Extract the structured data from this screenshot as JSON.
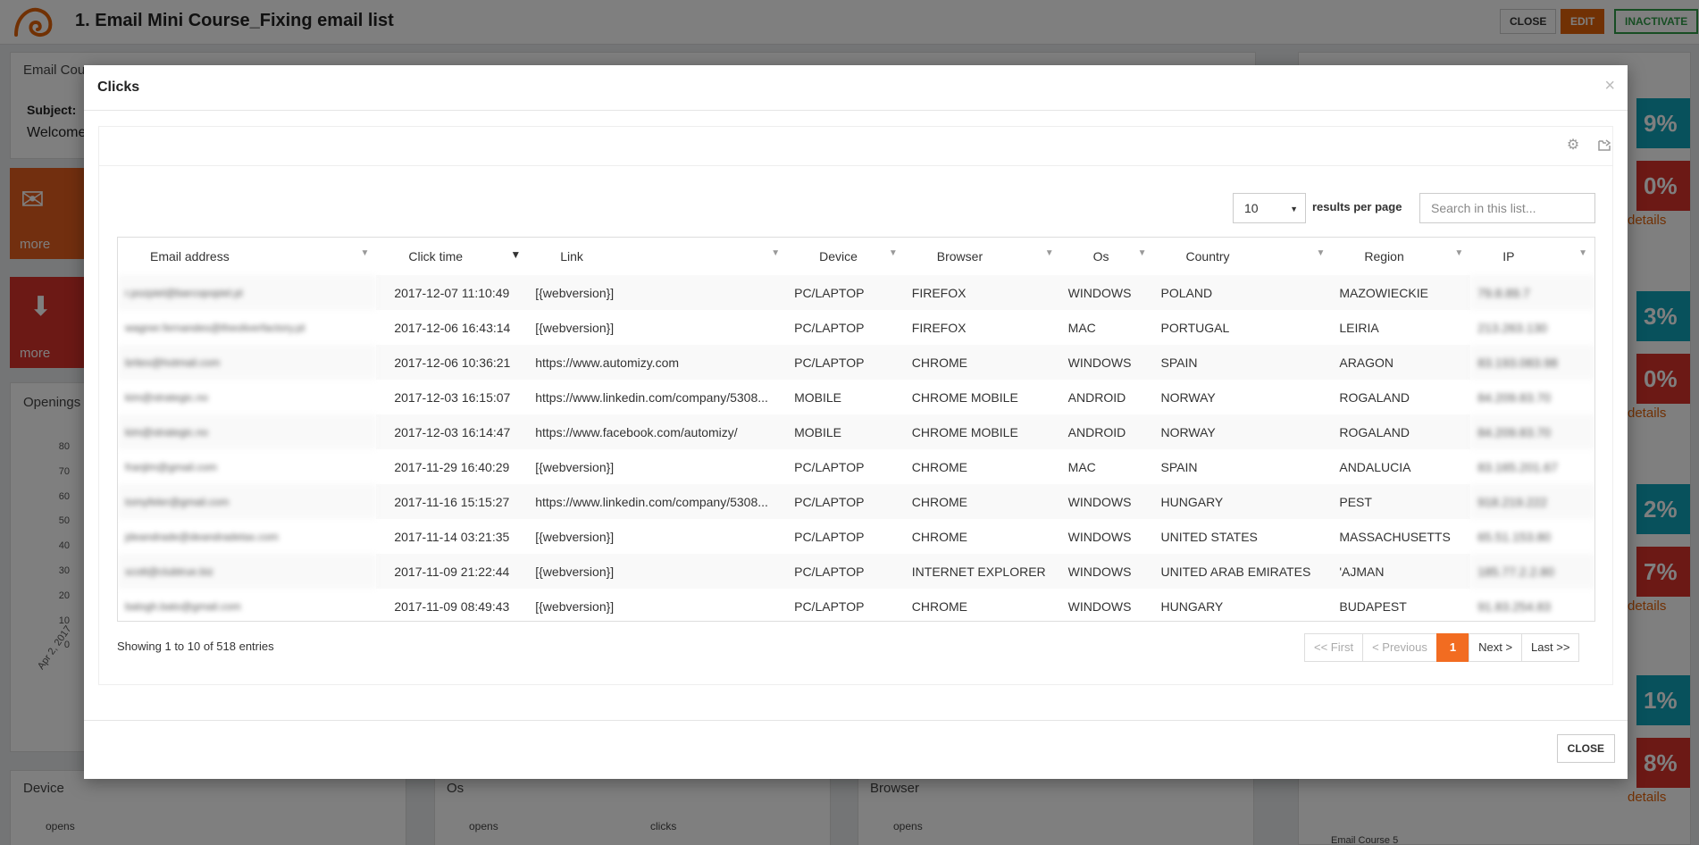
{
  "app": {
    "title": "1. Email Mini Course_Fixing email list",
    "close_label": "CLOSE",
    "edit_label": "EDIT",
    "inactivate_label": "INACTIVATE"
  },
  "background": {
    "email_panel_title": "Email Cou",
    "subject_label": "Subject:",
    "subject_value": "Welcome",
    "more_label_1": "more",
    "more_label_2": "more",
    "openings_title": "Openings",
    "y_ticks": [
      "80",
      "70",
      "60",
      "50",
      "40",
      "30",
      "20",
      "10",
      "0"
    ],
    "x_tick": "Apr 2, 2017",
    "device_title": "Device",
    "os_title": "Os",
    "browser_title": "Browser",
    "opens_label_1": "opens",
    "opens_label_2": "opens",
    "clicks_label": "clicks",
    "opens_label_3": "opens",
    "stats": [
      "9%",
      "0%",
      "3%",
      "0%",
      "2%",
      "7%",
      "1%",
      "8%"
    ],
    "details_label": "details",
    "side_footer_label": "Email Course 5"
  },
  "modal": {
    "title": "Clicks",
    "close_x": "×",
    "per_page_value": "10",
    "per_page_label": "results per page",
    "search_placeholder": "Search in this list...",
    "columns": [
      "Email address",
      "Click time",
      "Link",
      "Device",
      "Browser",
      "Os",
      "Country",
      "Region",
      "IP"
    ],
    "rows": [
      [
        "r.pozpiel@barcopopiel.pl",
        "2017-12-07 11:10:49",
        "[{webversion}]",
        "PC/LAPTOP",
        "FIREFOX",
        "WINDOWS",
        "POLAND",
        "MAZOWIECKIE",
        "79.8.89.7"
      ],
      [
        "wagner.fernandes@theoliverfactory.pt",
        "2017-12-06 16:43:14",
        "[{webversion}]",
        "PC/LAPTOP",
        "FIREFOX",
        "MAC",
        "PORTUGAL",
        "LEIRIA",
        "213.263.130"
      ],
      [
        "britex@hotmail.com",
        "2017-12-06 10:36:21",
        "https://www.automizy.com",
        "PC/LAPTOP",
        "CHROME",
        "WINDOWS",
        "SPAIN",
        "ARAGON",
        "83.193.083.98"
      ],
      [
        "kim@strategic.no",
        "2017-12-03 16:15:07",
        "https://www.linkedin.com/company/5308...",
        "MOBILE",
        "CHROME MOBILE",
        "ANDROID",
        "NORWAY",
        "ROGALAND",
        "84.209.83.70"
      ],
      [
        "kim@strategic.no",
        "2017-12-03 16:14:47",
        "https://www.facebook.com/automizy/",
        "MOBILE",
        "CHROME MOBILE",
        "ANDROID",
        "NORWAY",
        "ROGALAND",
        "84.209.83.70"
      ],
      [
        "franjlm@gmail.com",
        "2017-11-29 16:40:29",
        "[{webversion}]",
        "PC/LAPTOP",
        "CHROME",
        "MAC",
        "SPAIN",
        "ANDALUCIA",
        "83.165.201.67"
      ],
      [
        "tomyfeler@gmail.com",
        "2017-11-16 15:15:27",
        "https://www.linkedin.com/company/5308...",
        "PC/LAPTOP",
        "CHROME",
        "WINDOWS",
        "HUNGARY",
        "PEST",
        "918.219.222"
      ],
      [
        "jdeandrade@deandradetax.com",
        "2017-11-14 03:21:35",
        "[{webversion}]",
        "PC/LAPTOP",
        "CHROME",
        "WINDOWS",
        "UNITED STATES",
        "MASSACHUSETTS",
        "65.51.153.80"
      ],
      [
        "scott@clubtrue.biz",
        "2017-11-09 21:22:44",
        "[{webversion}]",
        "PC/LAPTOP",
        "INTERNET EXPLORER",
        "WINDOWS",
        "UNITED ARAB EMIRATES",
        "'AJMAN",
        "185.77.2.2.80"
      ],
      [
        "balogh.bato@gmail.com",
        "2017-11-09 08:49:43",
        "[{webversion}]",
        "PC/LAPTOP",
        "CHROME",
        "WINDOWS",
        "HUNGARY",
        "BUDAPEST",
        "91.83.254.83"
      ]
    ],
    "showing_text": "Showing 1 to 10 of 518 entries",
    "pager": {
      "first": "<< First",
      "previous": "< Previous",
      "current": "1",
      "next": "Next >",
      "last": "Last >>"
    },
    "close_label": "CLOSE"
  }
}
